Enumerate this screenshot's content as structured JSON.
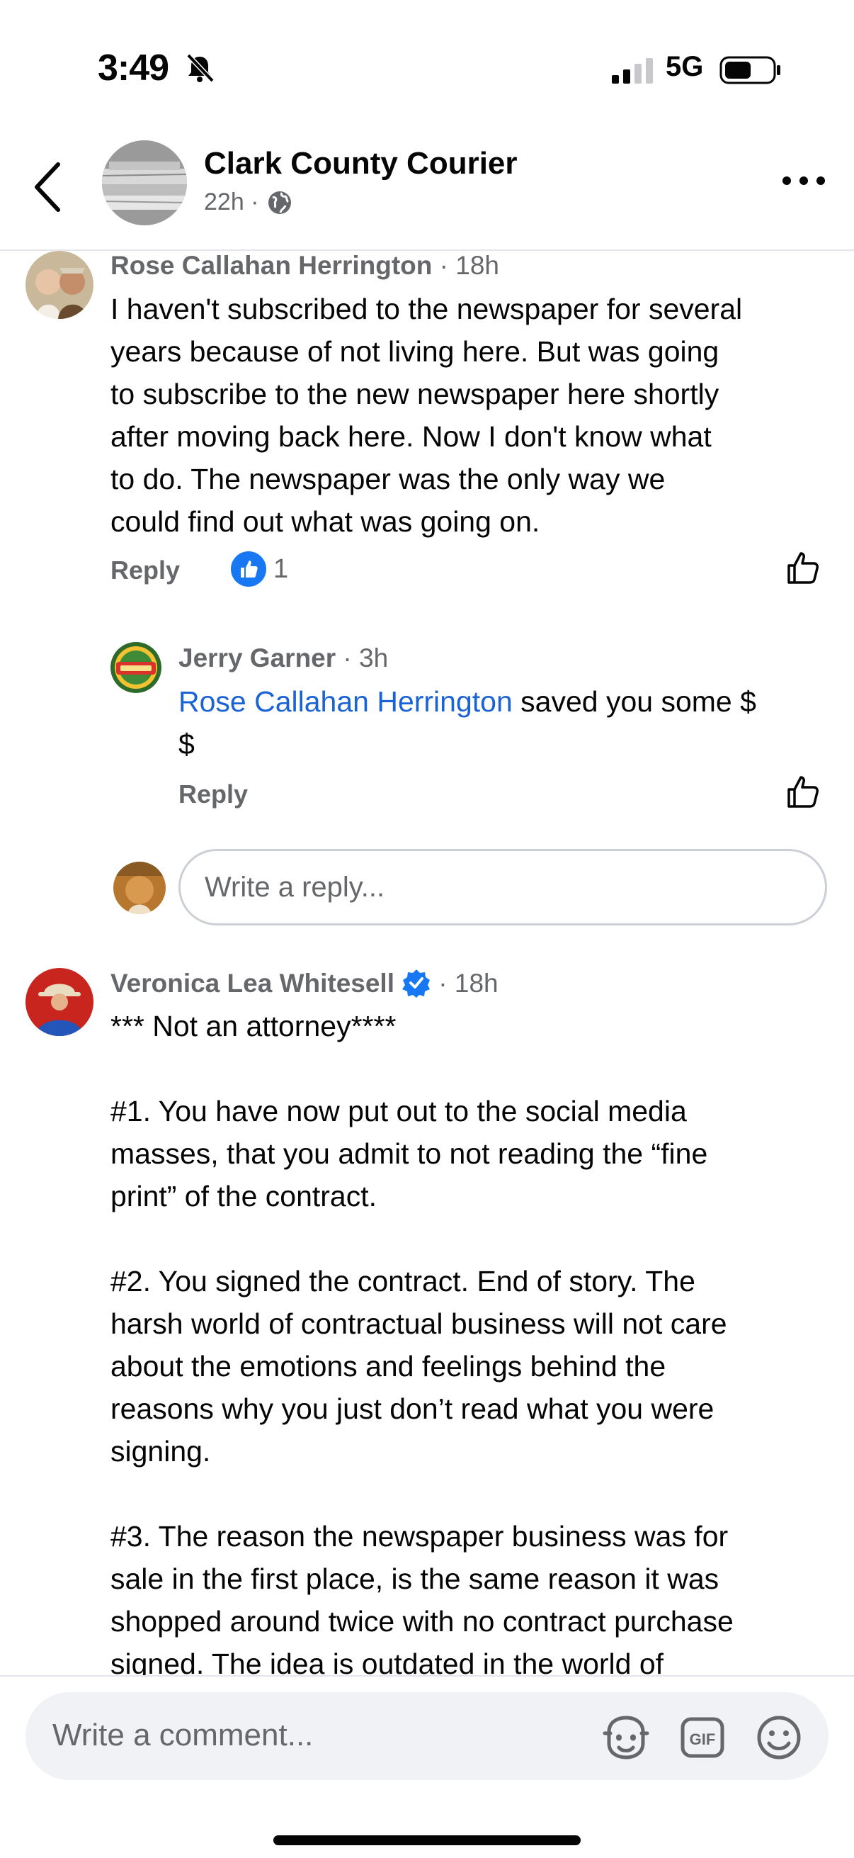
{
  "status_bar": {
    "time": "3:49",
    "network": "5G",
    "icons": [
      "bell-off-icon",
      "signal-icon",
      "battery-icon"
    ]
  },
  "header": {
    "page_name": "Clark County Courier",
    "post_age": "22h ·",
    "audience_icon": "globe-icon"
  },
  "comments": [
    {
      "author": "Rose Callahan Herrington",
      "meta": " · 18h",
      "text": "I haven't subscribed to the newspaper for several\nyears because of not living here.  But was going\nto subscribe to the new newspaper here shortly\nafter moving back here.   Now I don't know what\nto do.  The newspaper was the only way we\ncould find out what was going on.",
      "reply_label": "Reply",
      "reaction_count": "1",
      "replies": [
        {
          "author": "Jerry Garner",
          "meta": " · 3h",
          "mention": "Rose Callahan Herrington",
          "text": " saved you some $\n$",
          "reply_label": "Reply"
        }
      ],
      "reply_placeholder": "Write a reply..."
    },
    {
      "author": "Veronica Lea Whitesell",
      "meta": " · 18h",
      "verified": true,
      "text": "*** Not an attorney****\n\n#1. You have now put out to the social media\nmasses, that you admit to not reading the “fine\nprint” of the contract.\n\n#2. You signed the contract. End of story. The\nharsh world of contractual business will not care\nabout the emotions and feelings behind the\nreasons why you just don’t read what you were\nsigning.\n\n#3. The reason the newspaper business was for\nsale in the first place, is the same reason it was\nshopped around twice with no contract purchase\nsigned. The idea is outdated in the world of"
    }
  ],
  "composer": {
    "placeholder": "Write a comment...",
    "icons": [
      "avatar-sticker-icon",
      "gif-icon",
      "emoji-icon"
    ]
  },
  "colors": {
    "link": "#1a63d6",
    "like_blue": "#1877f2",
    "secondary_text": "#65676b",
    "input_bg": "#f0f2f5"
  }
}
